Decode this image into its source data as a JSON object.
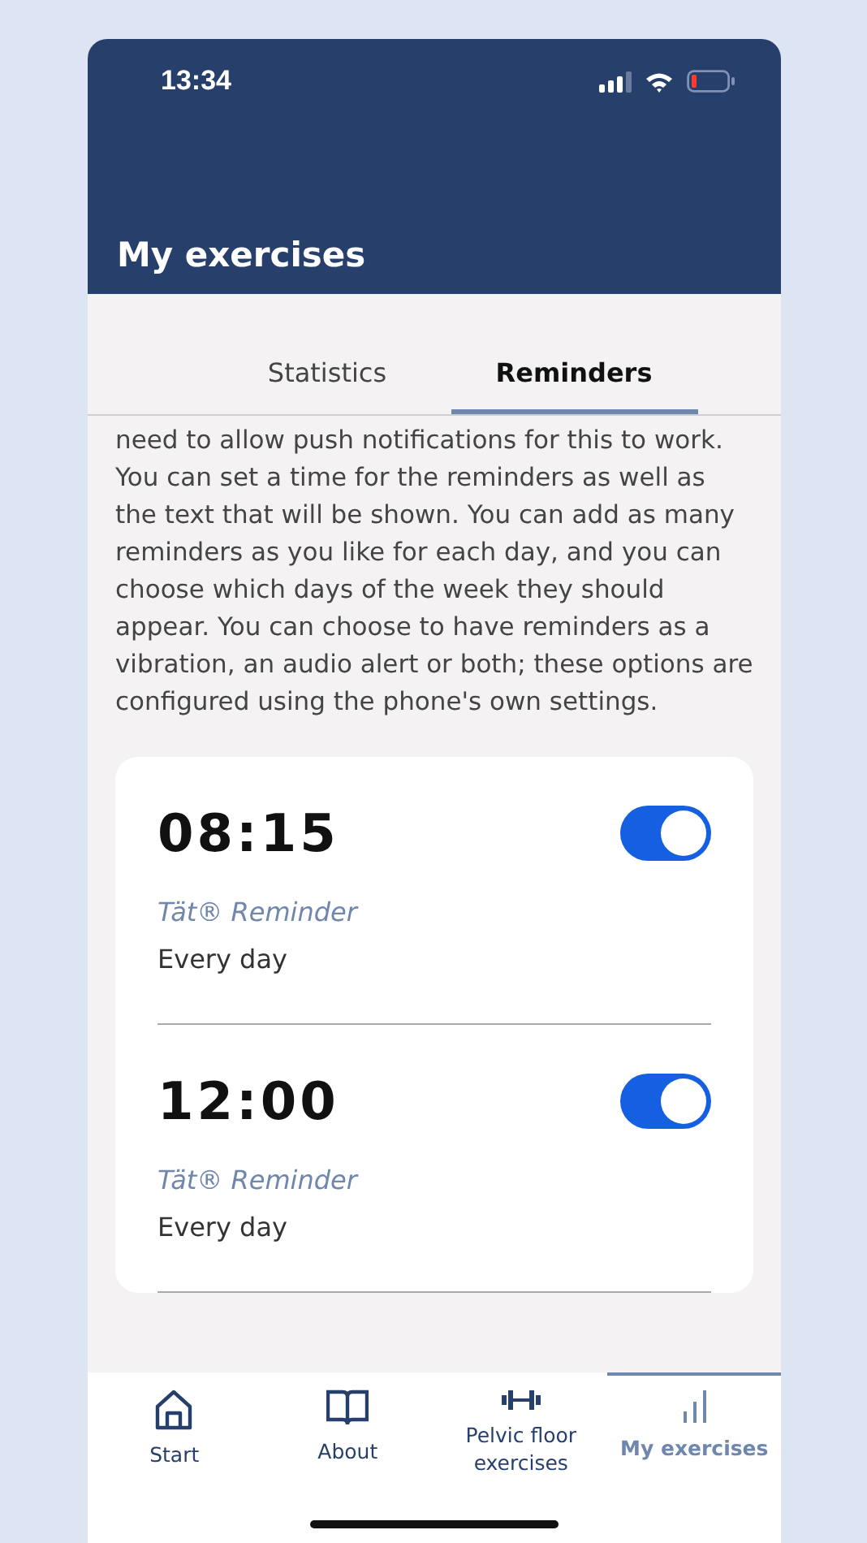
{
  "status_bar": {
    "time": "13:34"
  },
  "header": {
    "title": "My exercises"
  },
  "tabs": [
    {
      "label": "Statistics",
      "selected": false
    },
    {
      "label": "Reminders",
      "selected": true
    }
  ],
  "intro": "need to allow push notifications for this to work. You can set a time for the reminders as well as the text that will be shown. You can add as many reminders as you like for each day, and you can choose which days of the week they should appear. You can choose to have reminders as a vibration, an audio alert or both; these options are configured using the phone's own settings.",
  "reminders": [
    {
      "time": "08:15",
      "on": true,
      "label": "Tät® Reminder",
      "days": "Every day"
    },
    {
      "time": "12:00",
      "on": true,
      "label": "Tät® Reminder",
      "days": "Every day"
    }
  ],
  "bottom_nav": [
    {
      "kind": "home",
      "label": "Start",
      "selected": false
    },
    {
      "kind": "book",
      "label": "About",
      "selected": false
    },
    {
      "kind": "dumbbell",
      "label": "Pelvic floor exercises",
      "selected": false
    },
    {
      "kind": "chart",
      "label": "My exercises",
      "selected": true
    }
  ]
}
